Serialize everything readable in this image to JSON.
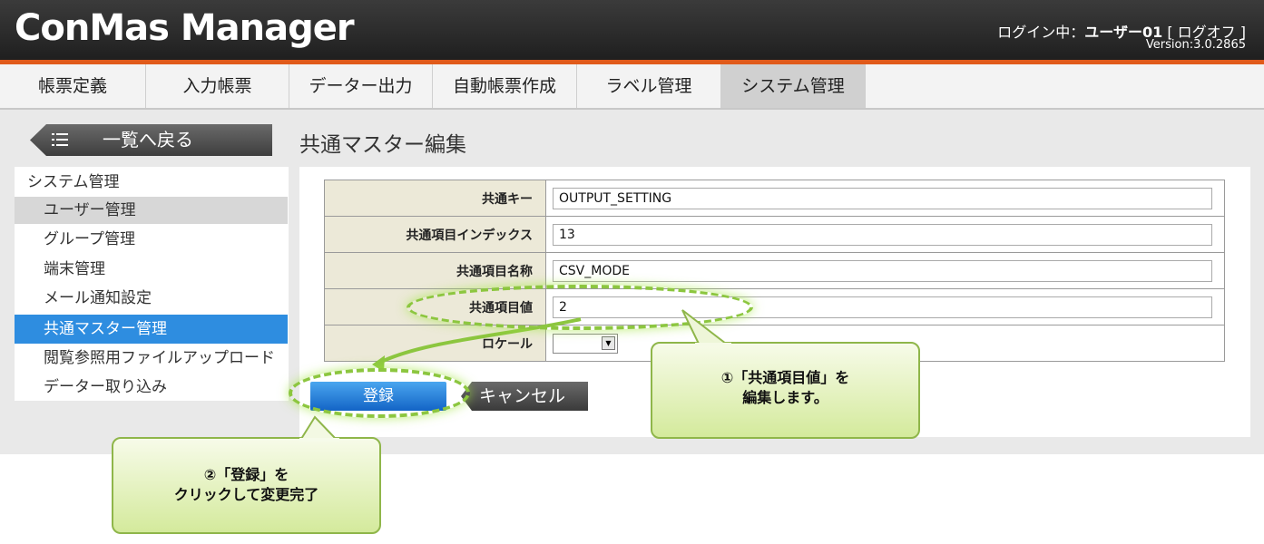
{
  "header": {
    "app_title": "ConMas Manager",
    "login_prefix": "ログイン中：",
    "user_name": "ユーザー01",
    "bracket_open": " [ ",
    "logoff_label": "ログオフ",
    "bracket_close": " ]",
    "version": "Version:3.0.2865"
  },
  "tabs": [
    {
      "label": "帳票定義"
    },
    {
      "label": "入力帳票"
    },
    {
      "label": "データー出力"
    },
    {
      "label": "自動帳票作成"
    },
    {
      "label": "ラベル管理"
    },
    {
      "label": "システム管理"
    }
  ],
  "back_button": {
    "label": "一覧へ戻る"
  },
  "page_title": "共通マスター編集",
  "sidebar": {
    "items": [
      {
        "label": "システム管理"
      },
      {
        "label": "ユーザー管理"
      },
      {
        "label": "グループ管理"
      },
      {
        "label": "端末管理"
      },
      {
        "label": "メール通知設定"
      },
      {
        "label": "共通マスター管理"
      },
      {
        "label": "閲覧参照用ファイルアップロード"
      },
      {
        "label": "データー取り込み"
      }
    ]
  },
  "form": {
    "rows": [
      {
        "label": "共通キー",
        "value": "OUTPUT_SETTING"
      },
      {
        "label": "共通項目インデックス",
        "value": "13"
      },
      {
        "label": "共通項目名称",
        "value": "CSV_MODE"
      },
      {
        "label": "共通項目値",
        "value": "2"
      },
      {
        "label": "ロケール",
        "value": ""
      }
    ],
    "register_label": "登録",
    "cancel_label": "キャンセル"
  },
  "annotations": {
    "callout1_line1": "①「共通項目値」を",
    "callout1_line2": "編集します。",
    "callout2_line1": "②「登録」を",
    "callout2_line2": "クリックして変更完了",
    "accent_color": "#8cc63f"
  }
}
